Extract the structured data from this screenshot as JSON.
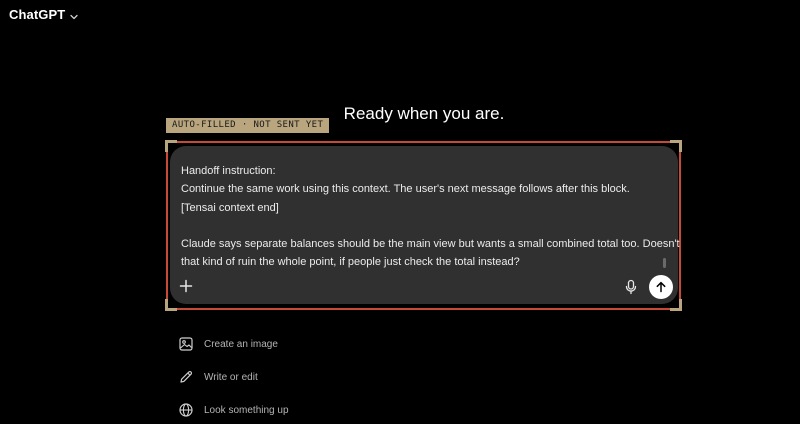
{
  "header": {
    "app_title": "ChatGPT",
    "model_menu_icon": "chevron-down-icon"
  },
  "main": {
    "heading": "Ready when you are."
  },
  "autofill": {
    "label": "AUTO-FILLED · NOT SENT YET",
    "tag_color": "#b9a57e",
    "frame_color": "#c74a37"
  },
  "composer": {
    "lines": [
      "Handoff instruction:",
      "Continue the same work using this context. The user's next message follows after this block.",
      "[Tensai context end]",
      "",
      "Claude says separate balances should be the main view but wants a small combined total too. Doesn't",
      "that kind of ruin the whole point, if people just check the total instead?"
    ],
    "add_icon": "plus-icon",
    "mic_icon": "microphone-icon",
    "send_icon": "arrow-up-icon"
  },
  "suggestions": [
    {
      "label": "Create an image",
      "icon": "image-icon"
    },
    {
      "label": "Write or edit",
      "icon": "pencil-icon"
    },
    {
      "label": "Look something up",
      "icon": "globe-icon"
    }
  ]
}
